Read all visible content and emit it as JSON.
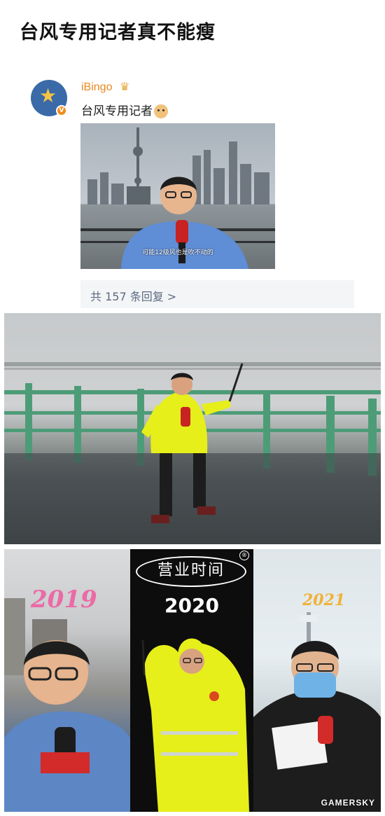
{
  "article": {
    "title": "台风专用记者真不能瘦"
  },
  "post": {
    "username": "iBingo",
    "crown_icon": "crown-icon",
    "text": "台风专用记者",
    "emoji_icon": "doge-emoji-icon",
    "video_caption": "可能12级风也是吹不动的",
    "replies_label": "共 157 条回复 >"
  },
  "collage": {
    "label_2019": "2019",
    "label_2020": "2020",
    "label_2021": "2021",
    "sign_text": "营业时间",
    "sign_mark": "®"
  },
  "watermark": "GAMERSKY",
  "colors": {
    "username": "#e8891f",
    "reply_text": "#5a6a80",
    "label_2019": "#ec6aa6",
    "label_2021": "#f0b236",
    "raincoat": "#e8f000"
  }
}
